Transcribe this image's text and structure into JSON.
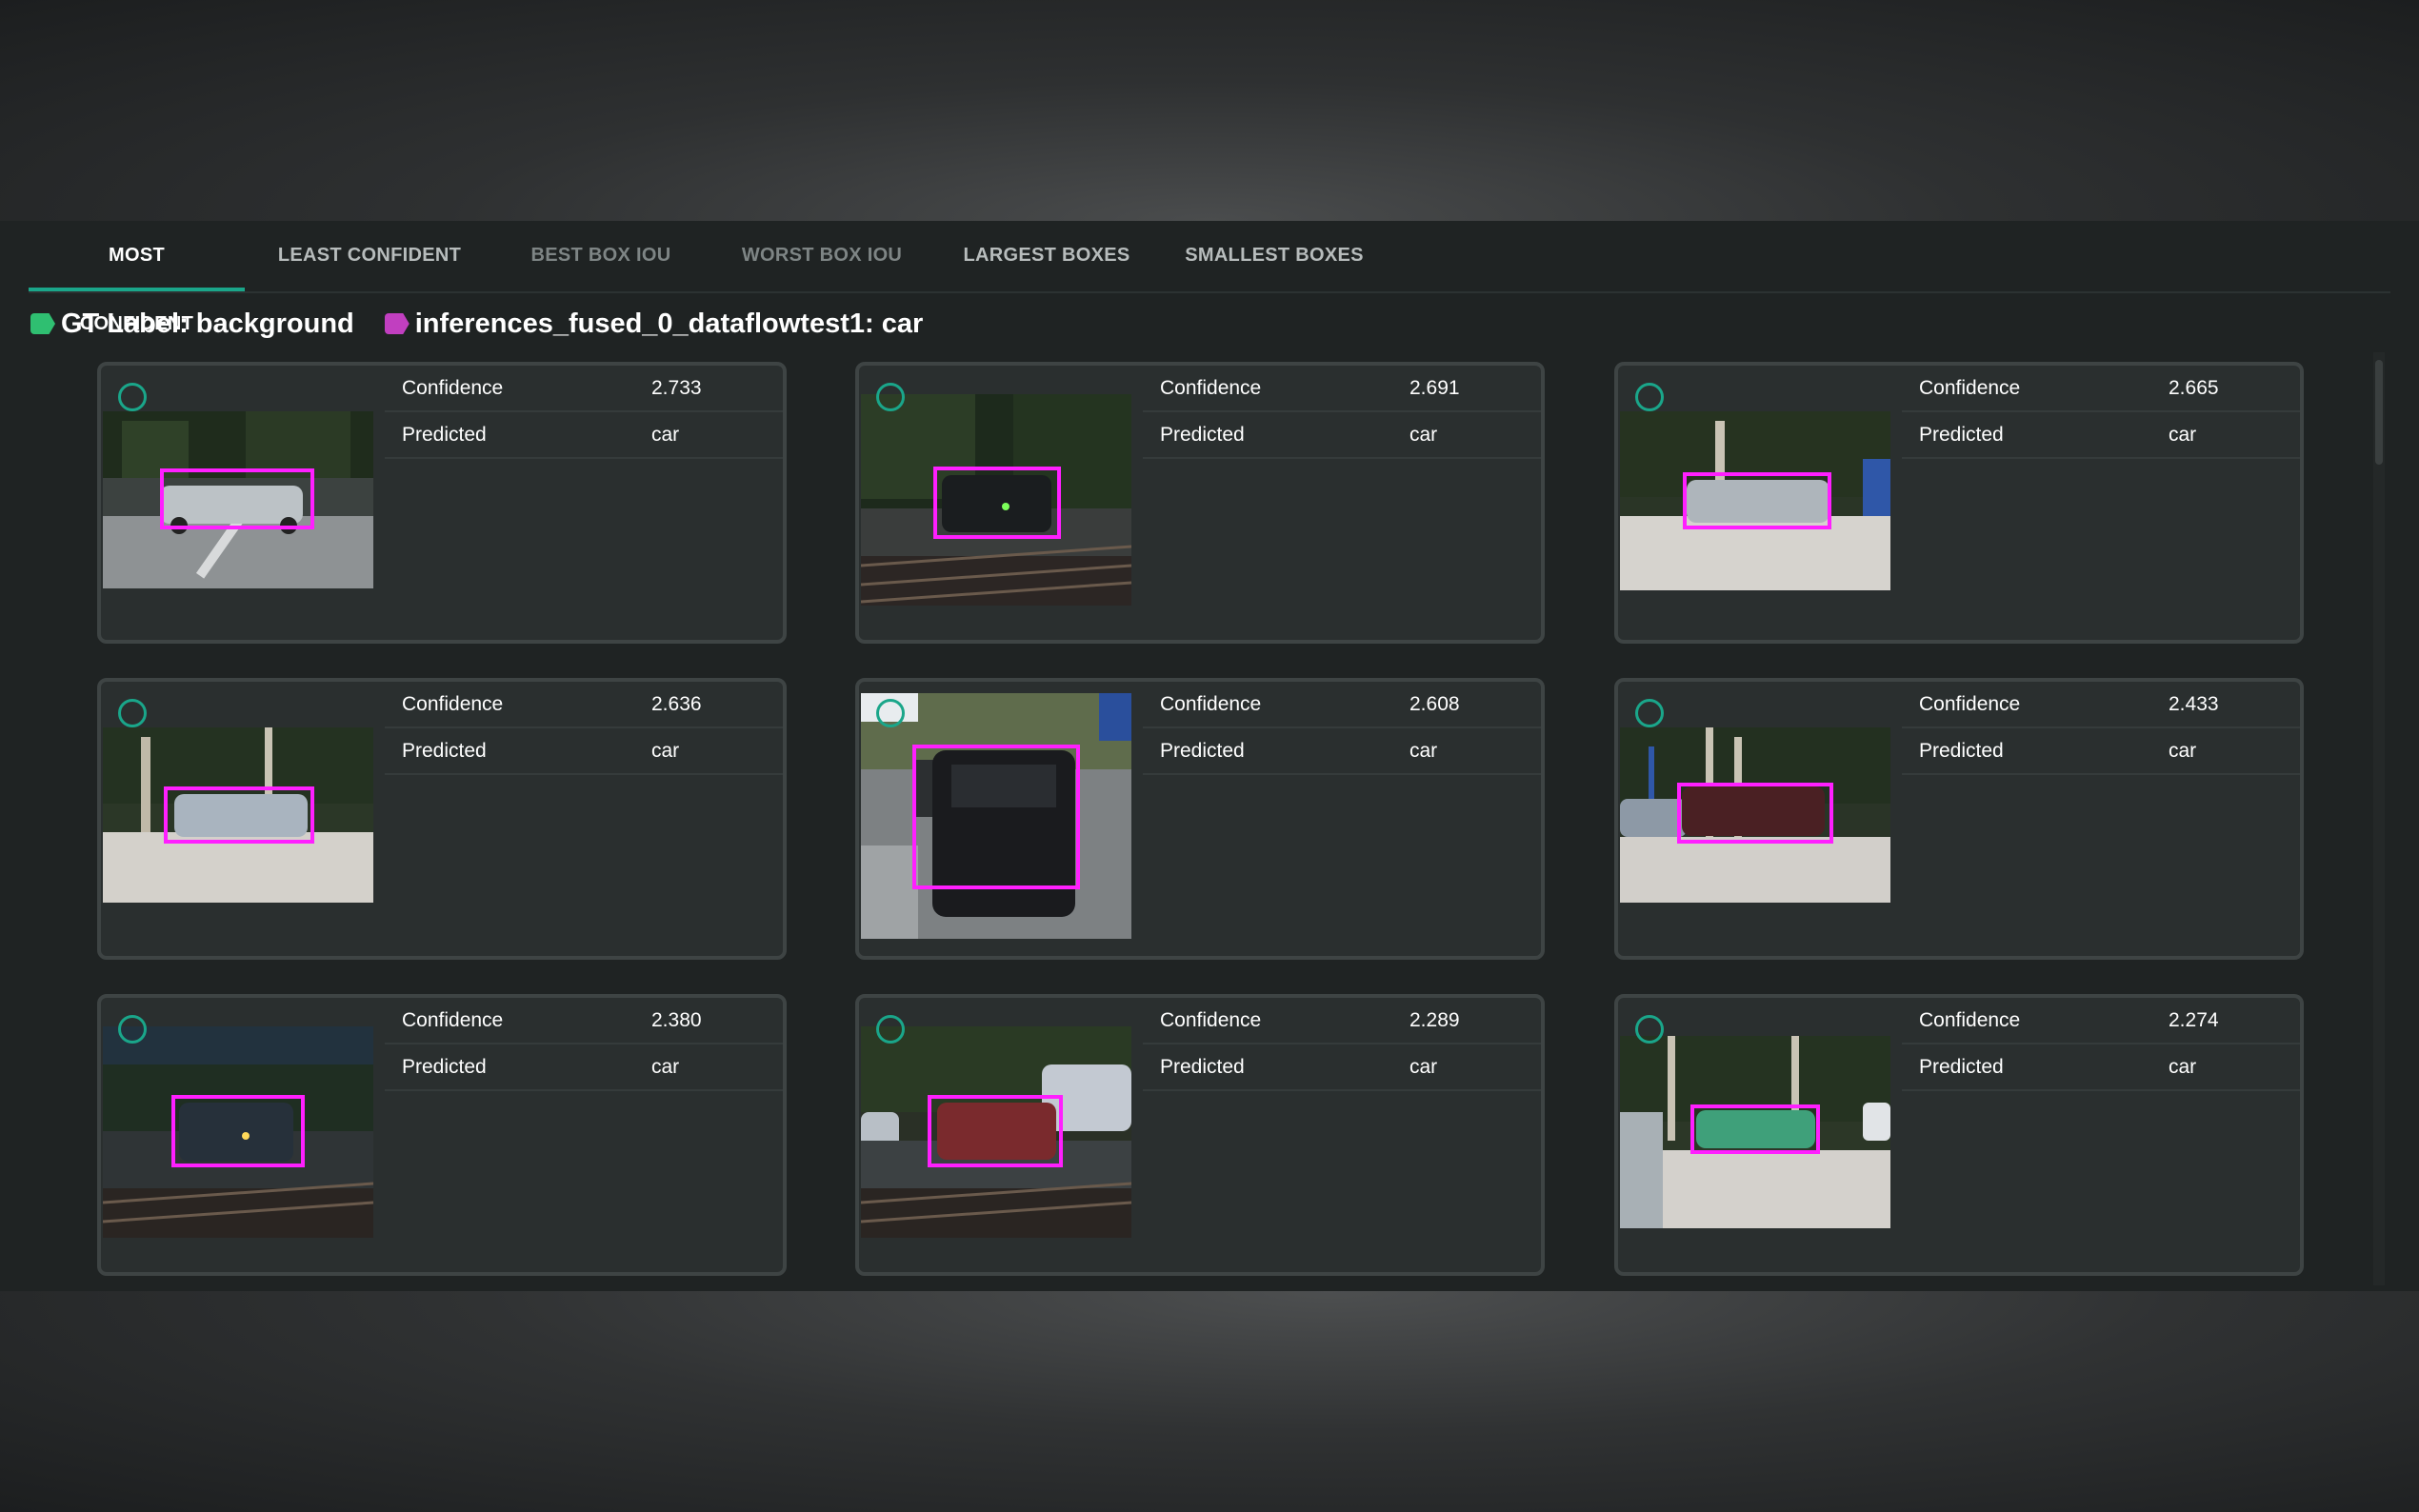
{
  "tabs": [
    {
      "label": "MOST CONFIDENT",
      "state": "active"
    },
    {
      "label": "LEAST CONFIDENT",
      "state": "normal"
    },
    {
      "label": "BEST BOX IOU",
      "state": "dim"
    },
    {
      "label": "WORST BOX IOU",
      "state": "dim"
    },
    {
      "label": "LARGEST BOXES",
      "state": "normal"
    },
    {
      "label": "SMALLEST BOXES",
      "state": "normal"
    }
  ],
  "labels": {
    "gt": {
      "text": "GT Label: background",
      "color": "#2fbf71"
    },
    "inference": {
      "text": "inferences_fused_0_dataflowtest1: car",
      "color": "#c13fc0"
    }
  },
  "colors": {
    "accent": "#1aa68a",
    "box": "#ff1fff"
  },
  "card_fields": {
    "confidence_label": "Confidence",
    "predicted_label": "Predicted"
  },
  "cards": [
    {
      "confidence": "2.733",
      "predicted": "car"
    },
    {
      "confidence": "2.691",
      "predicted": "car"
    },
    {
      "confidence": "2.665",
      "predicted": "car"
    },
    {
      "confidence": "2.636",
      "predicted": "car"
    },
    {
      "confidence": "2.608",
      "predicted": "car"
    },
    {
      "confidence": "2.433",
      "predicted": "car"
    },
    {
      "confidence": "2.380",
      "predicted": "car"
    },
    {
      "confidence": "2.289",
      "predicted": "car"
    },
    {
      "confidence": "2.274",
      "predicted": "car"
    }
  ]
}
